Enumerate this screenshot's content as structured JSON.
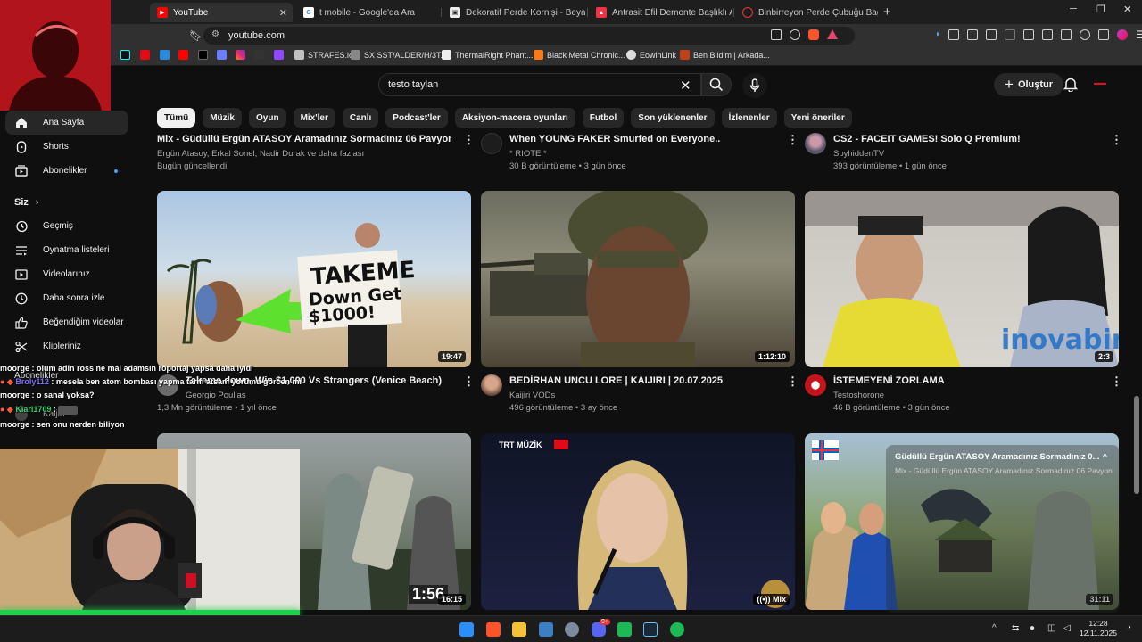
{
  "browser": {
    "tabs": [
      {
        "title": "YouTube",
        "active": true
      },
      {
        "title": "t mobile - Google'da Ara"
      },
      {
        "title": "Dekoratif Perde Kornişi - Beyaz, Siyah"
      },
      {
        "title": "Antrasit Efil Demonte Başlıklı Ahşap"
      },
      {
        "title": "Binbirreyon Perde Çubuğu Bağlantı P"
      }
    ],
    "url": "youtube.com",
    "bookmarks": [
      "STRAFES.io",
      "SX SST/ALDER/H/3T...",
      "ThermalRight Phant...",
      "Black Metal Chronic...",
      "EowinLink",
      "Ben Bildim | Arkada..."
    ]
  },
  "yt": {
    "search": {
      "value": "testo taylan"
    },
    "create_label": "Oluştur",
    "chips": [
      "Tümü",
      "Müzik",
      "Oyun",
      "Mix'ler",
      "Canlı",
      "Podcast'ler",
      "Aksiyon-macera oyunları",
      "Futbol",
      "Son yüklenenler",
      "İzlenenler",
      "Yeni öneriler"
    ],
    "sidebar": {
      "top": [
        {
          "label": "Ana Sayfa"
        },
        {
          "label": "Shorts"
        },
        {
          "label": "Abonelikler"
        }
      ],
      "you_header": "Siz",
      "you": [
        {
          "label": "Geçmiş"
        },
        {
          "label": "Oynatma listeleri"
        },
        {
          "label": "Videolarınız"
        },
        {
          "label": "Daha sonra izle"
        },
        {
          "label": "Beğendiğim videolar"
        },
        {
          "label": "Klipleriniz"
        }
      ],
      "subs_header": "Abonelikler",
      "sub_channel": "Kaijiri"
    },
    "row1": [
      {
        "title": "Mix - Güdüllü Ergün ATASOY Aramadınız Sormadınız 06 Pavyon",
        "channel": "Ergün Atasoy, Erkal Sonel, Nadir Durak ve daha fazlası",
        "meta": "Bugün güncellendi"
      },
      {
        "title": "When YOUNG FAKER Smurfed on Everyone..",
        "channel": "* RIOTE *",
        "meta": "30 B görüntüleme • 3 gün önce"
      },
      {
        "title": "CS2 - FACEIT GAMES! Solo Q Premium!",
        "channel": "SpyhiddenTV",
        "meta": "393 görüntüleme • 1 gün önce"
      }
    ],
    "row2": [
      {
        "title": "Takeme down, Win $1,000 Vs Strangers (Venice Beach)",
        "channel": "Georgio Poullas",
        "meta": "1,3 Mn görüntüleme • 1 yıl önce",
        "duration": "19:47",
        "sign1": "TAKEME",
        "sign2": "Down Get",
        "sign3": "$1000!"
      },
      {
        "title": "BEDİRHAN UNCU LORE | KAIJIRI | 20.07.2025",
        "channel": "Kaijiri VODs",
        "meta": "496 görüntüleme • 3 ay önce",
        "duration": "1:12:10"
      },
      {
        "title": "İSTEMEYENİ ZORLAMA",
        "channel": "Testoshorone",
        "meta": "46 B görüntüleme • 3 gün önce",
        "duration": "2:3",
        "watermark": "inovabin"
      }
    ],
    "row3": [
      {
        "duration": "16:15",
        "overlay": "1:56"
      },
      {
        "badge": "TRT MÜZİK",
        "mix_label": "Mix"
      },
      {
        "duration": "31:11"
      }
    ],
    "miniplayer": {
      "title": "Güdüllü Ergün ATASOY Aramadınız Sormadınız 0...",
      "subtitle": "Mix - Güdüllü Ergün ATASOY Aramadınız Sormadınız 06 Pavyon"
    }
  },
  "chat": [
    {
      "user": "moorge",
      "msg": "olum adin ross ne mal adamsın röportaj yapsa daha iyidi"
    },
    {
      "user": "Broly112",
      "msg": "mesela ben atom bombası yapma tarifi atsam yorumu görcen mi"
    },
    {
      "user": "moorge",
      "msg": "o sanal yoksa?"
    },
    {
      "user": "Kiari1709",
      "msg": ""
    },
    {
      "user": "moorge",
      "msg": "sen onu nerden biliyon"
    }
  ],
  "taskbar": {
    "time": "12:28",
    "date": "12.11.2025",
    "discord_badge": "9+"
  },
  "colors": {
    "yt_bg": "#0f0f0f",
    "chip_bg": "#272727",
    "youtube_red": "#ff0000",
    "cam_glow": "#1fd14a",
    "poster_red": "#b1141b"
  }
}
